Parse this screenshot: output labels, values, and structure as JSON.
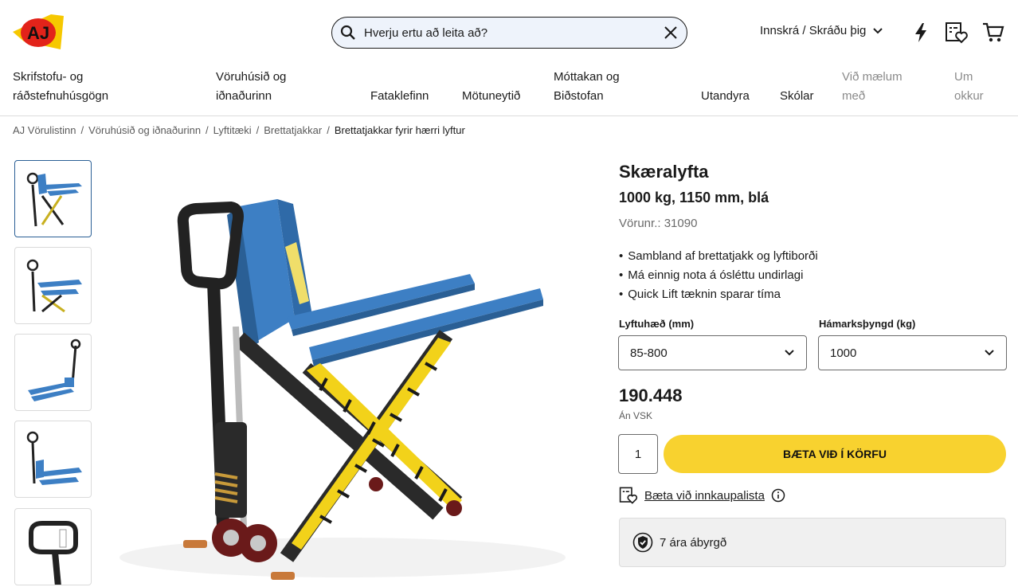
{
  "header": {
    "logo_text": "AJ",
    "search_placeholder": "Hverju ertu að leita að?",
    "login_label": "Innskrá / Skráðu þig"
  },
  "nav": {
    "items": [
      {
        "label_line1": "Skrifstofu- og",
        "label_line2": "ráðstefnuhúsgögn"
      },
      {
        "label_line1": "Vöruhúsið og",
        "label_line2": "iðnaðurinn"
      },
      {
        "label_line1": "",
        "label_line2": "Fataklefinn"
      },
      {
        "label_line1": "",
        "label_line2": "Mötuneytið"
      },
      {
        "label_line1": "Móttakan og",
        "label_line2": "Biðstofan"
      },
      {
        "label_line1": "",
        "label_line2": "Utandyra"
      },
      {
        "label_line1": "",
        "label_line2": "Skólar"
      },
      {
        "label_line1": "Við mælum",
        "label_line2": "með"
      },
      {
        "label_line1": "Um",
        "label_line2": "okkur"
      }
    ]
  },
  "breadcrumb": {
    "items": [
      "AJ Vörulistinn",
      "Vöruhúsið og iðnaðurinn",
      "Lyftitæki",
      "Brettatjakkar"
    ],
    "separator": "/",
    "current": "Brettatjakkar fyrir hærri lyftur"
  },
  "product": {
    "title": "Skæralyfta",
    "subtitle": "1000 kg, 1150 mm, blá",
    "sku": "Vörunr.: 31090",
    "bullets": [
      "Sambland af brettatjakk og lyftiborði",
      "Má einnig nota á ósléttu undirlagi",
      "Quick Lift tæknin sparar tíma"
    ],
    "options": [
      {
        "label": "Lyftuhæð (mm)",
        "value": "85-800"
      },
      {
        "label": "Hámarksþyngd (kg)",
        "value": "1000"
      }
    ],
    "price": "190.448",
    "vat_note": "Án VSK",
    "quantity": "1",
    "add_to_cart": "BÆTA VIÐ Í KÖRFU",
    "wishlist": "Bæta við innkaupalista",
    "warranty": "7 ára ábyrgð"
  },
  "colors": {
    "accent_yellow": "#f8d22f",
    "product_blue": "#3d7fc4",
    "logo_red": "#e2231a"
  }
}
